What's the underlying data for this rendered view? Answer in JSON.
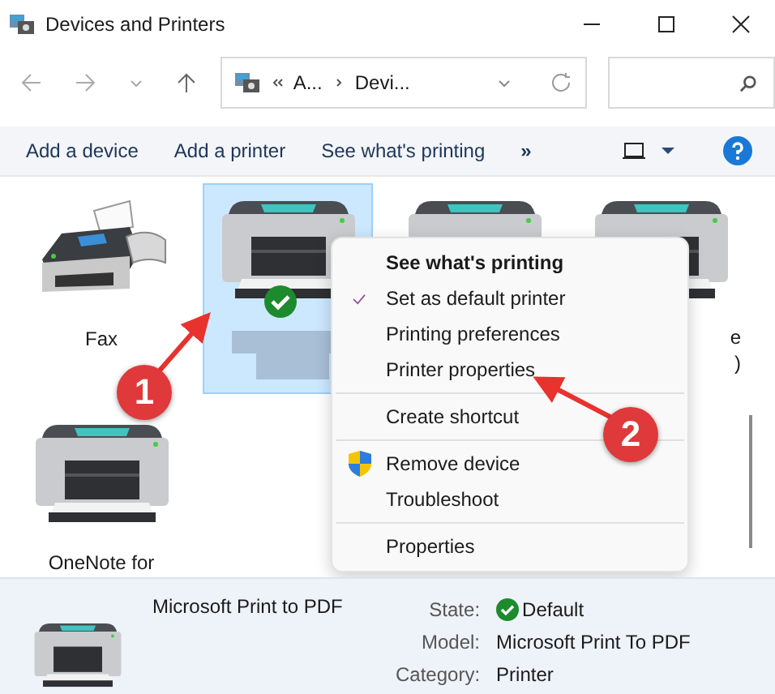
{
  "window": {
    "title": "Devices and Printers"
  },
  "address": {
    "segments": [
      "A...",
      "Devi..."
    ]
  },
  "toolbar": {
    "buttons": [
      "Add a device",
      "Add a printer",
      "See what's printing"
    ],
    "more": "»"
  },
  "devices": [
    {
      "kind": "fax",
      "label": "Fax",
      "selected": false,
      "default": false
    },
    {
      "kind": "printer",
      "selected": true,
      "default": true,
      "label_redacted": true
    },
    {
      "kind": "printer",
      "selected": false
    },
    {
      "kind": "printer",
      "selected": false,
      "label_fragments": [
        "e",
        ")"
      ]
    },
    {
      "kind": "printer",
      "label": "OneNote for",
      "selected": false,
      "default": false
    }
  ],
  "context_menu": [
    {
      "kind": "item",
      "label": "See what's printing",
      "bold": true,
      "checked": false
    },
    {
      "kind": "item",
      "label": "Set as default printer",
      "bold": false,
      "checked": true
    },
    {
      "kind": "item",
      "label": "Printing preferences",
      "bold": false,
      "checked": false
    },
    {
      "kind": "item",
      "label": "Printer properties",
      "bold": false,
      "checked": false
    },
    {
      "kind": "separator"
    },
    {
      "kind": "item",
      "label": "Create shortcut",
      "bold": false,
      "checked": false
    },
    {
      "kind": "separator"
    },
    {
      "kind": "secure_item",
      "label": "Remove device",
      "bold": false,
      "checked": false
    },
    {
      "kind": "item",
      "label": "Troubleshoot",
      "bold": false,
      "checked": false
    },
    {
      "kind": "separator"
    },
    {
      "kind": "item",
      "label": "Properties",
      "bold": false,
      "checked": false
    }
  ],
  "annotations": [
    {
      "number": "1"
    },
    {
      "number": "2"
    }
  ],
  "details": {
    "name": "Microsoft Print to PDF",
    "fields": [
      {
        "label": "State:",
        "value": "Default",
        "ok": true
      },
      {
        "label": "Model:",
        "value": "Microsoft Print To PDF",
        "ok": false
      },
      {
        "label": "Category:",
        "value": "Printer",
        "ok": false
      }
    ]
  }
}
